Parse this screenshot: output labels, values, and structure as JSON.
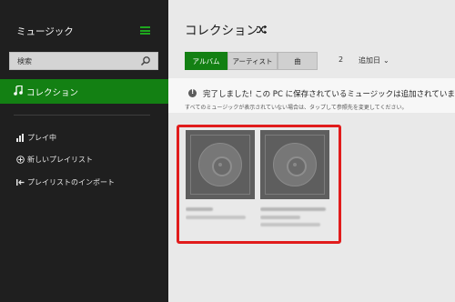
{
  "sidebar": {
    "app_title": "ミュージック",
    "search_placeholder": "検索",
    "nav_active": "コレクション",
    "items": [
      {
        "label": "プレイ中"
      },
      {
        "label": "新しいプレイリスト"
      },
      {
        "label": "プレイリストのインポート"
      }
    ]
  },
  "main": {
    "title": "コレクション",
    "tabs": [
      {
        "label": "アルバム",
        "active": true
      },
      {
        "label": "アーティスト",
        "active": false
      },
      {
        "label": "曲",
        "active": false
      }
    ],
    "count": "2",
    "sort_label": "追加日",
    "notice": {
      "title": "完了しました! この PC に保存されているミュージックは追加されています。",
      "subtitle": "すべてのミュージックが表示されていない場合は、タップして参照先を変更してください。"
    }
  },
  "colors": {
    "accent": "#138013",
    "sidebar_bg": "#1f1f1f",
    "highlight": "#e11c1c"
  }
}
